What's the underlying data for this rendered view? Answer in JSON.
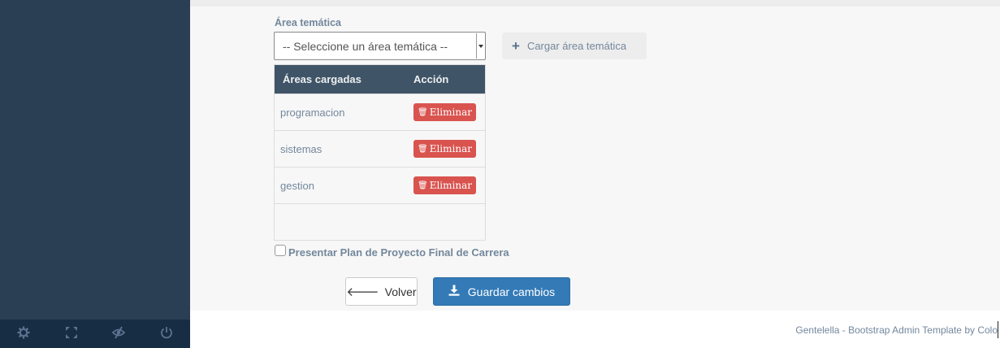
{
  "form": {
    "area_label": "Área temática",
    "select": {
      "selected": "-- Seleccione un área temática --"
    },
    "load_button_label": "Cargar área temática"
  },
  "table": {
    "headers": [
      "Áreas cargadas",
      "Acción"
    ],
    "rows": [
      {
        "area": "programacion",
        "action": "Eliminar"
      },
      {
        "area": "sistemas",
        "action": "Eliminar"
      },
      {
        "area": "gestion",
        "action": "Eliminar"
      }
    ]
  },
  "checkbox": {
    "label": "Presentar Plan de Proyecto Final de Carrera",
    "checked": false
  },
  "buttons": {
    "back": "Volver",
    "save": "Guardar cambios"
  },
  "footer": {
    "text": "Gentelella - Bootstrap Admin Template by Colo"
  },
  "sidebar_footer": {
    "icons": [
      "settings-icon",
      "fullscreen-icon",
      "lock-icon",
      "power-icon"
    ]
  },
  "colors": {
    "sidebar": "#2A3F54",
    "table_header": "#405467",
    "danger": "#D9534F",
    "primary": "#337AB7"
  }
}
